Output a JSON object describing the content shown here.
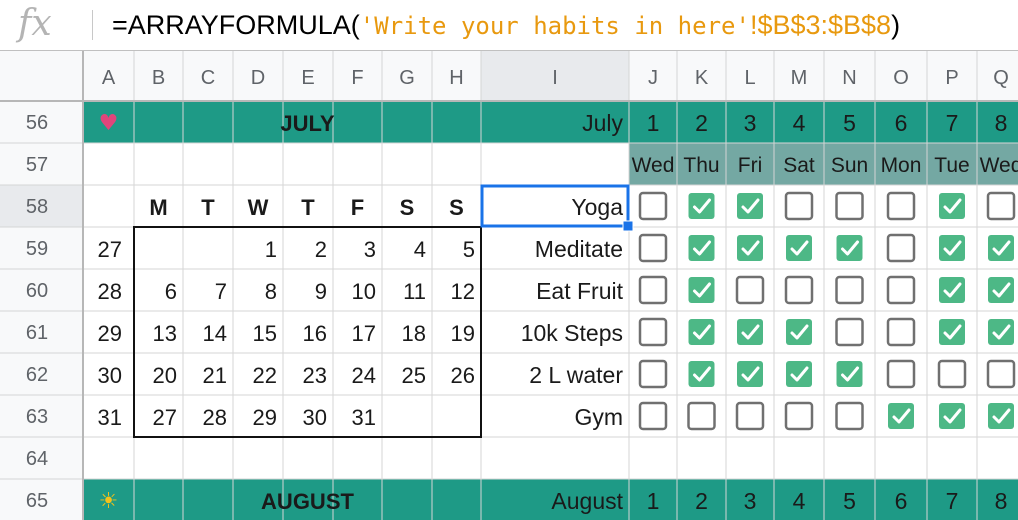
{
  "formula_bar": {
    "fx_label": "fx",
    "prefix": "=ARRAYFORMULA(",
    "quoted": "'Write your habits in here'",
    "range": "!$B$3:$B$8",
    "suffix": ")"
  },
  "column_headers": [
    "A",
    "B",
    "C",
    "D",
    "E",
    "F",
    "G",
    "H",
    "I",
    "J",
    "K",
    "L",
    "M",
    "N",
    "O",
    "P",
    "Q"
  ],
  "row_headers": [
    "56",
    "57",
    "58",
    "59",
    "60",
    "61",
    "62",
    "63",
    "64",
    "65"
  ],
  "july": {
    "icon": "bikini-icon",
    "month_title": "JULY",
    "month_label": "July",
    "day_numbers": [
      "1",
      "2",
      "3",
      "4",
      "5",
      "6",
      "7",
      "8"
    ],
    "weekdays": [
      "Wed",
      "Thu",
      "Fri",
      "Sat",
      "Sun",
      "Mon",
      "Tue",
      "Wed"
    ]
  },
  "mini_calendar": {
    "headers": [
      "M",
      "T",
      "W",
      "T",
      "F",
      "S",
      "S"
    ],
    "week_numbers": [
      "27",
      "28",
      "29",
      "30",
      "31"
    ],
    "weeks": [
      [
        "",
        "",
        "1",
        "2",
        "3",
        "4",
        "5"
      ],
      [
        "6",
        "7",
        "8",
        "9",
        "10",
        "11",
        "12"
      ],
      [
        "13",
        "14",
        "15",
        "16",
        "17",
        "18",
        "19"
      ],
      [
        "20",
        "21",
        "22",
        "23",
        "24",
        "25",
        "26"
      ],
      [
        "27",
        "28",
        "29",
        "30",
        "31",
        "",
        ""
      ]
    ]
  },
  "habits": [
    {
      "name": "Yoga",
      "checks": [
        false,
        true,
        true,
        false,
        false,
        false,
        true,
        false
      ]
    },
    {
      "name": "Meditate",
      "checks": [
        false,
        true,
        true,
        true,
        true,
        false,
        true,
        true
      ]
    },
    {
      "name": "Eat Fruit",
      "checks": [
        false,
        true,
        false,
        false,
        false,
        false,
        true,
        true
      ]
    },
    {
      "name": "10k Steps",
      "checks": [
        false,
        true,
        true,
        true,
        false,
        false,
        true,
        true
      ]
    },
    {
      "name": "2 L water",
      "checks": [
        false,
        true,
        true,
        true,
        true,
        false,
        false,
        false
      ]
    },
    {
      "name": "Gym",
      "checks": [
        false,
        false,
        false,
        false,
        false,
        true,
        true,
        true
      ]
    }
  ],
  "august": {
    "icon": "sun-icon",
    "month_title": "AUGUST",
    "month_label": "August",
    "day_numbers": [
      "1",
      "2",
      "3",
      "4",
      "5",
      "6",
      "7",
      "8"
    ]
  },
  "colors": {
    "teal_band": "#1e9a86",
    "teal_day_cells": "#1e9a86",
    "weekday_bg": "#74a8a3",
    "check_green": "#4db886",
    "grid_line": "#d5d5d5",
    "header_bg": "#f8f9fa",
    "selected_header_bg": "#e8eaed",
    "selection_blue": "#1a73e8"
  }
}
